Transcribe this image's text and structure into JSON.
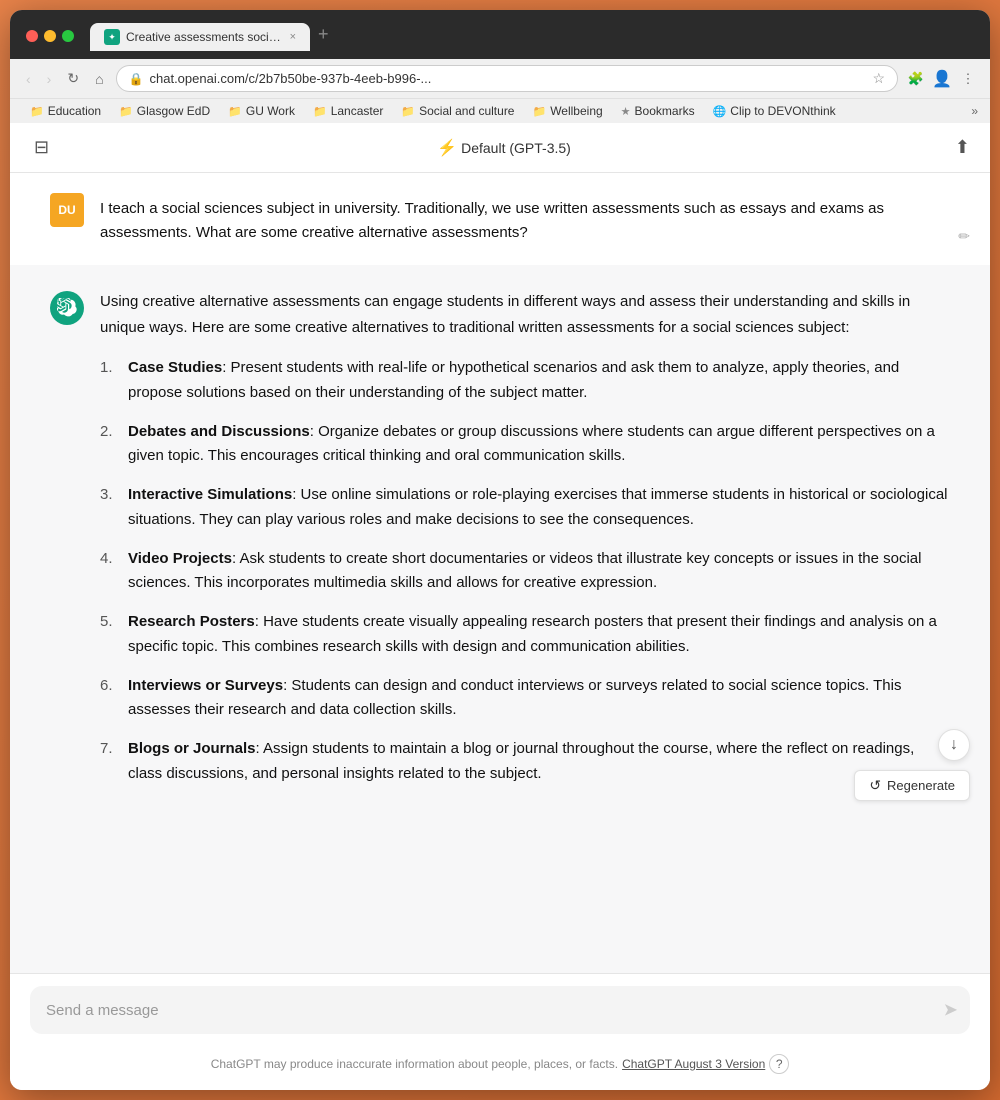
{
  "browser": {
    "tab": {
      "title": "Creative assessments social s...",
      "favicon": "✦",
      "close": "×",
      "new_tab": "+"
    },
    "nav": {
      "back": "‹",
      "forward": "›",
      "reload": "↻",
      "home": "⌂",
      "address": "chat.openai.com/c/2b7b50be-937b-4eeb-b996-...",
      "more": "⋮"
    },
    "bookmarks": [
      {
        "icon": "📁",
        "label": "Education"
      },
      {
        "icon": "📁",
        "label": "Glasgow EdD"
      },
      {
        "icon": "📁",
        "label": "GU Work"
      },
      {
        "icon": "📁",
        "label": "Lancaster"
      },
      {
        "icon": "📁",
        "label": "Social and culture"
      },
      {
        "icon": "📁",
        "label": "Wellbeing"
      },
      {
        "icon": "★",
        "label": "Bookmarks"
      },
      {
        "icon": "🌐",
        "label": "Clip to DEVONthink"
      }
    ]
  },
  "toolbar": {
    "model_label": "Default (GPT-3.5)",
    "flash_icon": "⚡"
  },
  "user_message": {
    "avatar": "DU",
    "text": "I teach a social sciences subject in university. Traditionally, we use written assessments such as essays and exams as assessments. What are some creative alternative assessments?"
  },
  "ai_message": {
    "intro": "Using creative alternative assessments can engage students in different ways and assess their understanding and skills in unique ways. Here are some creative alternatives to traditional written assessments for a social sciences subject:",
    "items": [
      {
        "num": "1.",
        "title": "Case Studies",
        "text": ": Present students with real-life or hypothetical scenarios and ask them to analyze, apply theories, and propose solutions based on their understanding of the subject matter."
      },
      {
        "num": "2.",
        "title": "Debates and Discussions",
        "text": ": Organize debates or group discussions where students can argue different perspectives on a given topic. This encourages critical thinking and oral communication skills."
      },
      {
        "num": "3.",
        "title": "Interactive Simulations",
        "text": ": Use online simulations or role-playing exercises that immerse students in historical or sociological situations. They can play various roles and make decisions to see the consequences."
      },
      {
        "num": "4.",
        "title": "Video Projects",
        "text": ": Ask students to create short documentaries or videos that illustrate key concepts or issues in the social sciences. This incorporates multimedia skills and allows for creative expression."
      },
      {
        "num": "5.",
        "title": "Research Posters",
        "text": ": Have students create visually appealing research posters that present their findings and analysis on a specific topic. This combines research skills with design and communication abilities."
      },
      {
        "num": "6.",
        "title": "Interviews or Surveys",
        "text": ": Students can design and conduct interviews or surveys related to social science topics. This assesses their research and data collection skills."
      },
      {
        "num": "7.",
        "title": "Blogs or Journals",
        "text": ": Assign students to maintain a blog or journal throughout the course, where the reflect on readings, class discussions, and personal insights related to the subject."
      }
    ]
  },
  "input": {
    "placeholder": "Send a message"
  },
  "footer": {
    "disclaimer": "ChatGPT may produce inaccurate information about people, places, or facts.",
    "link_text": "ChatGPT August 3 Version",
    "question": "?"
  },
  "buttons": {
    "regenerate": "Regenerate",
    "regenerate_icon": "↺"
  }
}
